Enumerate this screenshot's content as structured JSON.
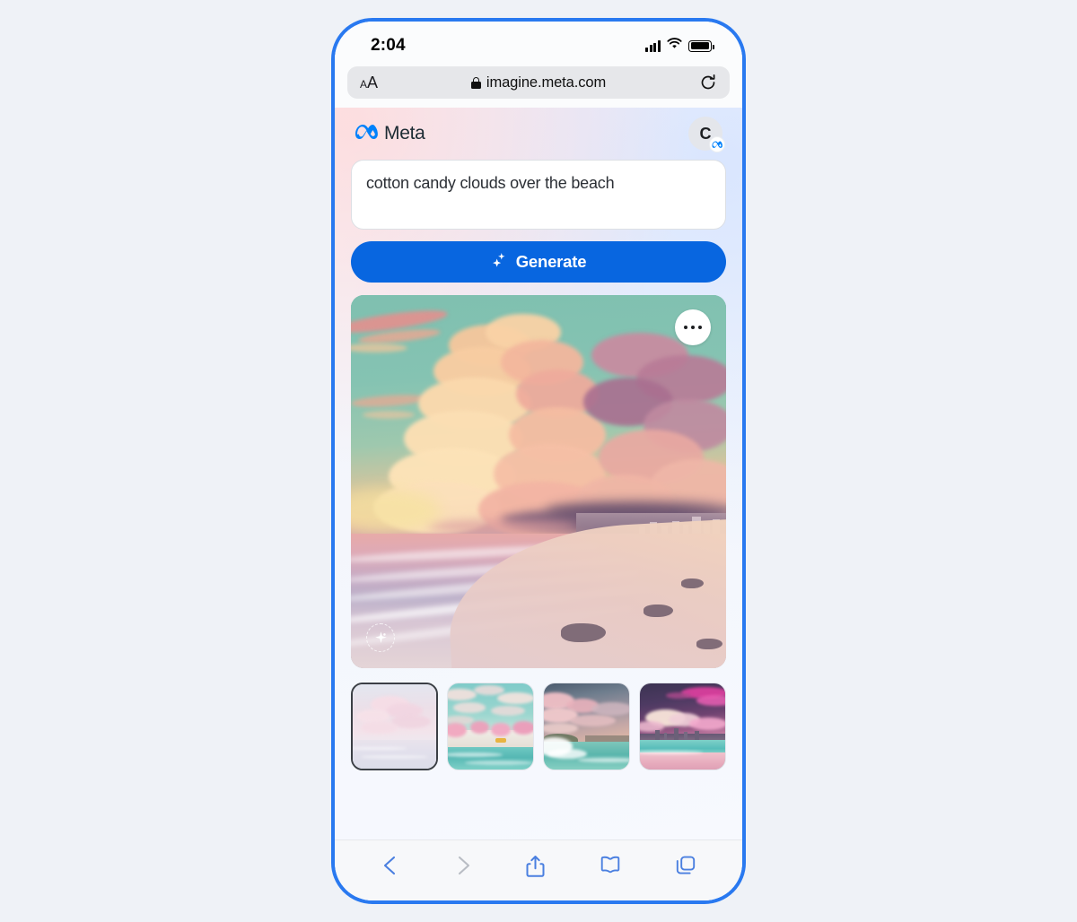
{
  "page": {
    "background_color": "#eff2f7",
    "frame_color": "#2979f0"
  },
  "status_bar": {
    "time": "2:04",
    "icons": [
      "cellular-signal-icon",
      "wifi-icon",
      "battery-icon"
    ]
  },
  "browser": {
    "url_bar": {
      "text_size_label": "AA",
      "small_a": "A",
      "big_a": "A",
      "lock_icon": "lock-icon",
      "url": "imagine.meta.com",
      "reload_icon": "reload-icon"
    },
    "toolbar": [
      {
        "name": "back-button",
        "icon": "chevron-left-icon",
        "enabled": true
      },
      {
        "name": "forward-button",
        "icon": "chevron-right-icon",
        "enabled": false
      },
      {
        "name": "share-button",
        "icon": "share-icon",
        "enabled": true
      },
      {
        "name": "bookmarks-button",
        "icon": "book-icon",
        "enabled": true
      },
      {
        "name": "tabs-button",
        "icon": "tabs-icon",
        "enabled": true
      }
    ]
  },
  "app": {
    "brand": {
      "logo_icon": "meta-infinity-icon",
      "name": "Meta",
      "logo_color": "#0081fb"
    },
    "avatar": {
      "initial": "C",
      "badge_icon": "meta-infinity-badge-icon"
    },
    "prompt": {
      "value": "cotton candy clouds over the beach",
      "placeholder": "Describe an image"
    },
    "generate_button": {
      "label": "Generate",
      "icon": "sparkle-icon",
      "color": "#0866e0"
    },
    "result_image": {
      "alt": "cotton candy clouds over the beach",
      "menu_icon": "ellipsis-icon",
      "watermark_icon": "ai-watermark-icon"
    },
    "thumbnails": [
      {
        "name": "thumbnail-1",
        "alt": "pale pink clouds over calm sea",
        "selected": true
      },
      {
        "name": "thumbnail-2",
        "alt": "pink trees on white village coastline",
        "selected": false
      },
      {
        "name": "thumbnail-3",
        "alt": "pink clouds over crashing wave and coast",
        "selected": false
      },
      {
        "name": "thumbnail-4",
        "alt": "magenta clouds over city skyline beach",
        "selected": false
      }
    ]
  }
}
